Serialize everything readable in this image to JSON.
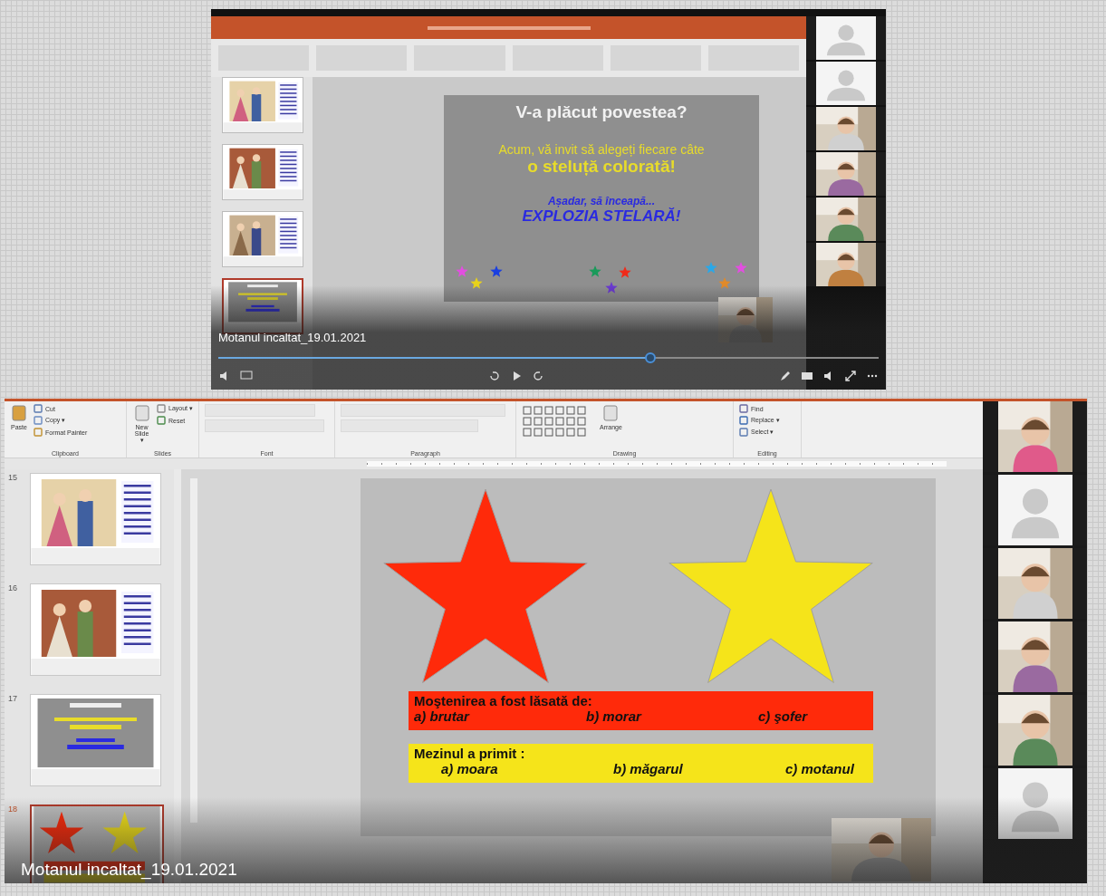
{
  "top_video": {
    "slide": {
      "title": "V-a plăcut povestea?",
      "invite": "Acum, vă invit să alegeți fiecare câte",
      "invite_bold": "o steluță colorată!",
      "lead": "Așadar, să înceapă...",
      "headline": "EXPLOZIA STELARĂ!",
      "star_marks": [
        {
          "color": "#e24ee0"
        },
        {
          "color": "#e8d21a"
        },
        {
          "color": "#1a3fe0"
        },
        {
          "color": "#1a9a5a"
        },
        {
          "color": "#f02a1a"
        },
        {
          "color": "#6a3ad0"
        },
        {
          "color": "#2aa8e8"
        },
        {
          "color": "#e08a2a"
        },
        {
          "color": "#e24ee0"
        }
      ]
    },
    "thumbnails": [
      {
        "kind": "picture",
        "selected": false
      },
      {
        "kind": "picture",
        "selected": false
      },
      {
        "kind": "picture",
        "selected": false
      },
      {
        "kind": "text",
        "selected": true
      }
    ],
    "caption": "Motanul incaltat_19.01.2021",
    "seek": {
      "level": 0.655
    },
    "participants": [
      {
        "kind": "avatar"
      },
      {
        "kind": "avatar"
      },
      {
        "kind": "video"
      },
      {
        "kind": "video"
      },
      {
        "kind": "video"
      },
      {
        "kind": "video"
      }
    ]
  },
  "bottom_video": {
    "ribbon": [
      {
        "label": "Clipboard",
        "big": "Paste",
        "items": [
          "Cut",
          "Copy ▾",
          "Format Painter"
        ]
      },
      {
        "label": "Slides",
        "big": "New Slide ▾",
        "items": [
          "Layout ▾",
          "Reset"
        ]
      },
      {
        "label": "Font"
      },
      {
        "label": "Paragraph"
      },
      {
        "label": "Drawing",
        "big": "Arrange"
      },
      {
        "label": "Editing",
        "items": [
          "Find",
          "Replace ▾",
          "Select ▾"
        ]
      }
    ],
    "thumbnails": [
      {
        "number": "15",
        "kind": "picture",
        "selected": false
      },
      {
        "number": "16",
        "kind": "picture",
        "selected": false
      },
      {
        "number": "17",
        "kind": "text",
        "selected": false
      },
      {
        "number": "18",
        "kind": "stars",
        "selected": true
      }
    ],
    "slide": {
      "big_stars": [
        {
          "color": "#ff2a0a"
        },
        {
          "color": "#f5e41a"
        }
      ],
      "questions": [
        {
          "prompt": "Moştenirea a fost lăsată de:",
          "options": [
            "a) brutar",
            "b) morar",
            "c) şofer"
          ],
          "color": "#ff2a0a"
        },
        {
          "prompt": "Mezinul a primit :",
          "options": [
            "a) moara",
            "b) măgarul",
            "c) motanul"
          ],
          "color": "#f5e41a"
        }
      ]
    },
    "caption": "Motanul incaltat_19.01.2021",
    "participants": [
      {
        "kind": "video"
      },
      {
        "kind": "avatar"
      },
      {
        "kind": "video"
      },
      {
        "kind": "video"
      },
      {
        "kind": "video"
      },
      {
        "kind": "avatar"
      }
    ]
  }
}
